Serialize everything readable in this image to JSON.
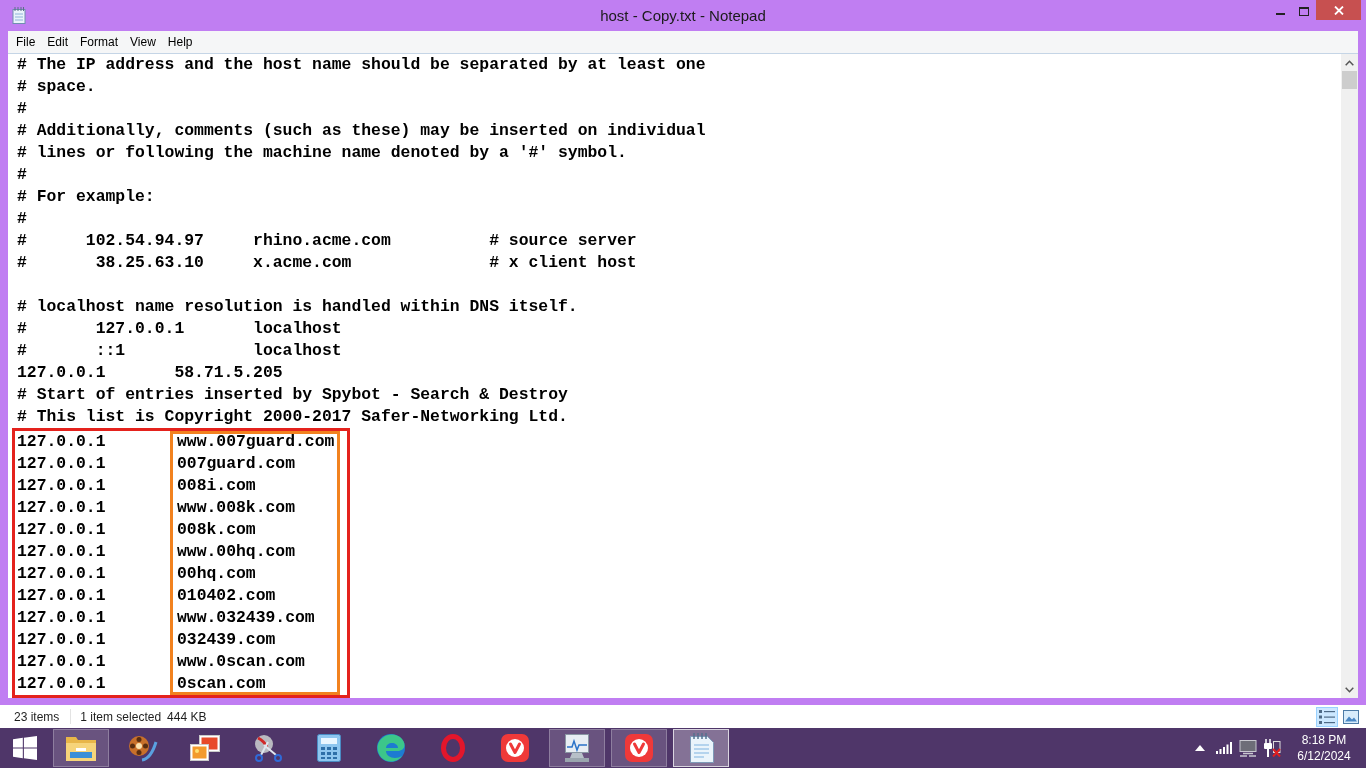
{
  "window": {
    "title": "host - Copy.txt - Notepad"
  },
  "menu": [
    "File",
    "Edit",
    "Format",
    "View",
    "Help"
  ],
  "editor": {
    "lines": [
      {
        "kind": "text",
        "text": "# The IP address and the host name should be separated by at least one"
      },
      {
        "kind": "text",
        "text": "# space."
      },
      {
        "kind": "text",
        "text": "#"
      },
      {
        "kind": "text",
        "text": "# Additionally, comments (such as these) may be inserted on individual"
      },
      {
        "kind": "text",
        "text": "# lines or following the machine name denoted by a '#' symbol."
      },
      {
        "kind": "text",
        "text": "#"
      },
      {
        "kind": "text",
        "text": "# For example:"
      },
      {
        "kind": "text",
        "text": "#"
      },
      {
        "kind": "text",
        "text": "#      102.54.94.97     rhino.acme.com          # source server"
      },
      {
        "kind": "text",
        "text": "#       38.25.63.10     x.acme.com              # x client host"
      },
      {
        "kind": "blank"
      },
      {
        "kind": "text",
        "text": "# localhost name resolution is handled within DNS itself."
      },
      {
        "kind": "text",
        "text": "#       127.0.0.1       localhost"
      },
      {
        "kind": "text",
        "text": "#       ::1             localhost"
      },
      {
        "kind": "text",
        "text": "127.0.0.1       58.71.5.205"
      },
      {
        "kind": "text",
        "text": "# Start of entries inserted by Spybot - Search & Destroy"
      },
      {
        "kind": "text",
        "text": "# This list is Copyright 2000-2017 Safer-Networking Ltd."
      }
    ],
    "entries": [
      {
        "ip": "127.0.0.1",
        "host": "www.007guard.com"
      },
      {
        "ip": "127.0.0.1",
        "host": "007guard.com"
      },
      {
        "ip": "127.0.0.1",
        "host": "008i.com"
      },
      {
        "ip": "127.0.0.1",
        "host": "www.008k.com"
      },
      {
        "ip": "127.0.0.1",
        "host": "008k.com"
      },
      {
        "ip": "127.0.0.1",
        "host": "www.00hq.com"
      },
      {
        "ip": "127.0.0.1",
        "host": "00hq.com"
      },
      {
        "ip": "127.0.0.1",
        "host": "010402.com"
      },
      {
        "ip": "127.0.0.1",
        "host": "www.032439.com"
      },
      {
        "ip": "127.0.0.1",
        "host": "032439.com"
      },
      {
        "ip": "127.0.0.1",
        "host": "www.0scan.com"
      },
      {
        "ip": "127.0.0.1",
        "host": "0scan.com"
      }
    ],
    "highlight_boxes": [
      {
        "kind": "entries",
        "color": "#e4221d"
      },
      {
        "kind": "hostnames",
        "color": "#f2821f"
      }
    ]
  },
  "status_bar": {
    "item_count": "23 items",
    "selection": "1 item selected",
    "size": "444 KB",
    "view_buttons": [
      {
        "kind": "details",
        "selected": true
      },
      {
        "kind": "image",
        "selected": false
      }
    ]
  },
  "taskbar": {
    "apps": [
      {
        "kind": "folder",
        "running": true,
        "focused": false
      },
      {
        "kind": "film",
        "running": false,
        "focused": false
      },
      {
        "kind": "photos",
        "running": false,
        "focused": false
      },
      {
        "kind": "scissors",
        "running": false,
        "focused": false
      },
      {
        "kind": "calculator",
        "running": false,
        "focused": false
      },
      {
        "kind": "swirl",
        "running": false,
        "focused": false
      },
      {
        "kind": "ring",
        "running": false,
        "focused": false
      },
      {
        "kind": "vlogo",
        "running": false,
        "focused": false
      },
      {
        "kind": "monitor",
        "running": true,
        "focused": false
      },
      {
        "kind": "vlogo",
        "running": true,
        "focused": false
      },
      {
        "kind": "notepad",
        "running": true,
        "focused": true
      }
    ],
    "clock_time": "8:18 PM",
    "clock_date": "6/12/2024"
  }
}
